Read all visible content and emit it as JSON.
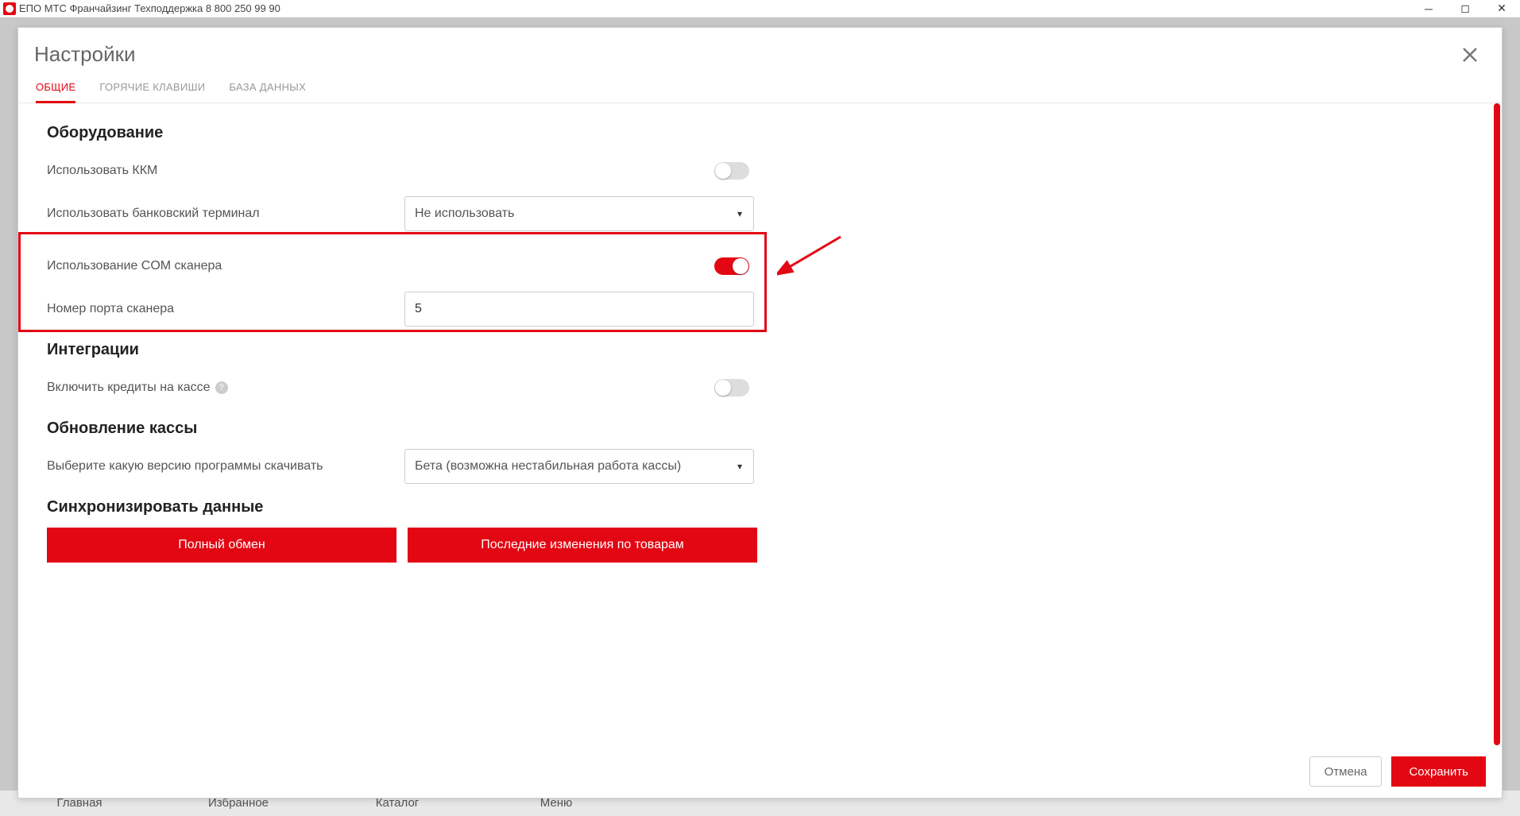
{
  "titlebar": {
    "title": "ЕПО МТС Франчайзинг Техподдержка 8 800 250 99 90"
  },
  "bgNav": {
    "items": [
      "Главная",
      "Избранное",
      "Каталог",
      "Меню"
    ]
  },
  "modal": {
    "title": "Настройки",
    "tabs": [
      "ОБЩИЕ",
      "ГОРЯЧИЕ КЛАВИШИ",
      "БАЗА ДАННЫХ"
    ],
    "sections": {
      "equipment": {
        "title": "Оборудование",
        "useKkm": "Использовать ККМ",
        "useTerminal": "Использовать банковский терминал",
        "terminalValue": "Не использовать",
        "useComScanner": "Использование COM сканера",
        "scannerPort": "Номер порта сканера",
        "scannerPortValue": "5"
      },
      "integrations": {
        "title": "Интеграции",
        "enableCredits": "Включить кредиты на кассе"
      },
      "update": {
        "title": "Обновление кассы",
        "versionLabel": "Выберите какую версию программы скачивать",
        "versionValue": "Бета (возможна нестабильная работа кассы)"
      },
      "sync": {
        "title": "Синхронизировать данные",
        "fullExchange": "Полный обмен",
        "lastChanges": "Последние изменения по товарам"
      }
    },
    "footer": {
      "cancel": "Отмена",
      "save": "Сохранить"
    }
  }
}
